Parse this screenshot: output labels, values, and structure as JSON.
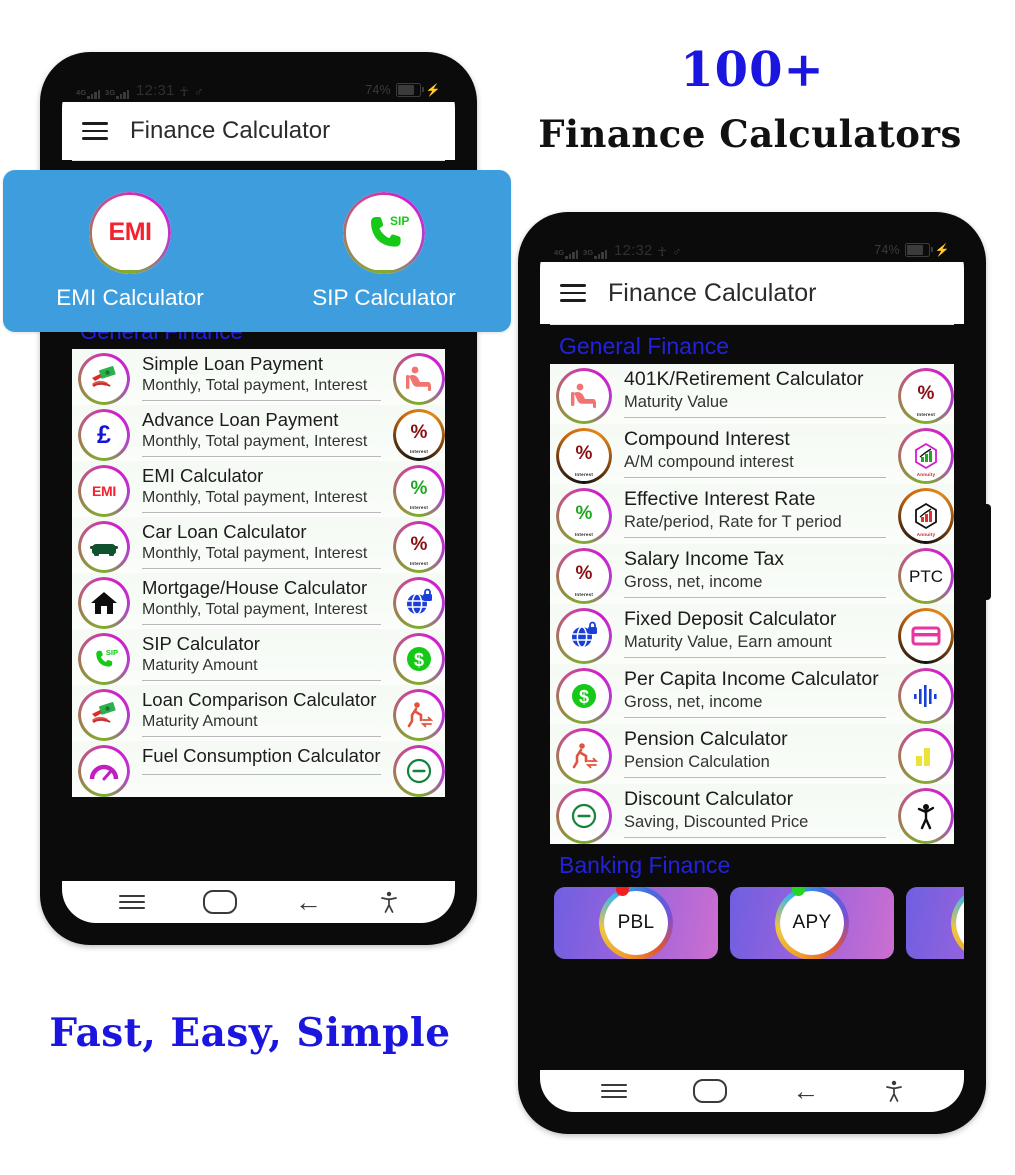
{
  "marketing": {
    "headline_count": "100+",
    "headline_text": "Finance Calculators",
    "tagline": "Fast, Easy, Simple"
  },
  "left_phone": {
    "status_bar": {
      "net1_label": "4G",
      "net2_label": "3G",
      "time": "12:31",
      "usb_icon": "usb-icon",
      "accessibility_icon": "accessibility-icon",
      "battery_percent": "74%",
      "charging_icon": "bolt-icon"
    },
    "app_bar": {
      "menu_icon": "hamburger-menu-icon",
      "title": "Finance Calculator"
    },
    "promo": {
      "items": [
        {
          "icon": "emi-icon",
          "icon_text": "EMI",
          "label": "EMI Calculator"
        },
        {
          "icon": "sip-phone-icon",
          "icon_text": "SIP",
          "label": "SIP Calculator"
        }
      ]
    },
    "section_title": "General Finance",
    "list": [
      {
        "icon": "money-hand-icon",
        "title": "Simple Loan Payment",
        "subtitle": "Monthly, Total payment, Interest",
        "right_icon": "retirement-chair-icon"
      },
      {
        "icon": "pound-sterling-icon",
        "title": "Advance Loan Payment",
        "subtitle": "Monthly, Total payment, Interest",
        "right_icon": "percent-interest-dark-icon"
      },
      {
        "icon": "emi-badge-icon",
        "title": "EMI Calculator",
        "subtitle": "Monthly, Total payment, Interest",
        "right_icon": "percent-interest-green-icon"
      },
      {
        "icon": "car-icon",
        "title": "Car Loan Calculator",
        "subtitle": "Monthly, Total payment, Interest",
        "right_icon": "percent-interest-red-icon"
      },
      {
        "icon": "house-icon",
        "title": "Mortgage/House Calculator",
        "subtitle": "Monthly, Total payment, Interest",
        "right_icon": "globe-lock-icon"
      },
      {
        "icon": "sip-phone-icon",
        "title": "SIP Calculator",
        "subtitle": "Maturity Amount",
        "right_icon": "dollar-coin-icon"
      },
      {
        "icon": "money-hand-icon",
        "title": "Loan Comparison Calculator",
        "subtitle": "Maturity Amount",
        "right_icon": "pension-walk-icon"
      },
      {
        "icon": "fuel-gauge-icon",
        "title": "Fuel Consumption Calculator",
        "subtitle": "",
        "right_icon": "discount-minus-icon"
      }
    ],
    "nav_bar": {
      "recents_icon": "recents-menu-icon",
      "home_icon": "home-pill-icon",
      "back_icon": "back-arrow-icon",
      "accessibility_icon": "accessibility-icon"
    }
  },
  "right_phone": {
    "status_bar": {
      "net1_label": "4G",
      "net2_label": "3G",
      "time": "12:32",
      "usb_icon": "usb-icon",
      "accessibility_icon": "accessibility-icon",
      "battery_percent": "74%",
      "charging_icon": "bolt-icon"
    },
    "app_bar": {
      "menu_icon": "hamburger-menu-icon",
      "title": "Finance Calculator"
    },
    "section_title": "General Finance",
    "list": [
      {
        "icon": "retirement-chair-icon",
        "title": "401K/Retirement Calculator",
        "subtitle": "Maturity Value",
        "right_icon": "percent-interest-red-icon"
      },
      {
        "icon": "percent-interest-dark-icon",
        "title": "Compound Interest",
        "subtitle": "A/M compound interest",
        "right_icon": "annuity-hex-green-icon"
      },
      {
        "icon": "percent-interest-green-icon",
        "title": "Effective Interest Rate",
        "subtitle": "Rate/period, Rate for T period",
        "right_icon": "annuity-hex-dark-icon"
      },
      {
        "icon": "percent-interest-red-icon",
        "title": "Salary Income Tax",
        "subtitle": "Gross, net, income",
        "right_icon": "ptc-text-icon"
      },
      {
        "icon": "globe-lock-icon",
        "title": "Fixed Deposit Calculator",
        "subtitle": "Maturity Value, Earn amount",
        "right_icon": "card-pink-icon"
      },
      {
        "icon": "dollar-coin-icon",
        "title": "Per Capita Income Calculator",
        "subtitle": "Gross, net, income",
        "right_icon": "equalizer-blue-icon"
      },
      {
        "icon": "pension-walk-icon",
        "title": "Pension Calculator",
        "subtitle": "Pension Calculation",
        "right_icon": "bar-chart-yellow-icon"
      },
      {
        "icon": "discount-minus-icon",
        "title": "Discount Calculator",
        "subtitle": "Saving, Discounted Price",
        "right_icon": "person-cheer-icon"
      }
    ],
    "section_title_2": "Banking Finance",
    "cards": [
      {
        "label": "PBL",
        "dot_color": "#f02020"
      },
      {
        "label": "APY",
        "dot_color": "#25d425"
      },
      {
        "label": "",
        "dot_color": "#f02020"
      }
    ],
    "nav_bar": {
      "recents_icon": "recents-menu-icon",
      "home_icon": "home-pill-icon",
      "back_icon": "back-arrow-icon",
      "accessibility_icon": "accessibility-icon"
    }
  },
  "colors": {
    "promo_blue": "#3e9ddd",
    "section_heading": "#2222dd",
    "marketing_blue": "#1a16e0",
    "emi_red": "#f5222d",
    "sip_green": "#16c916"
  }
}
